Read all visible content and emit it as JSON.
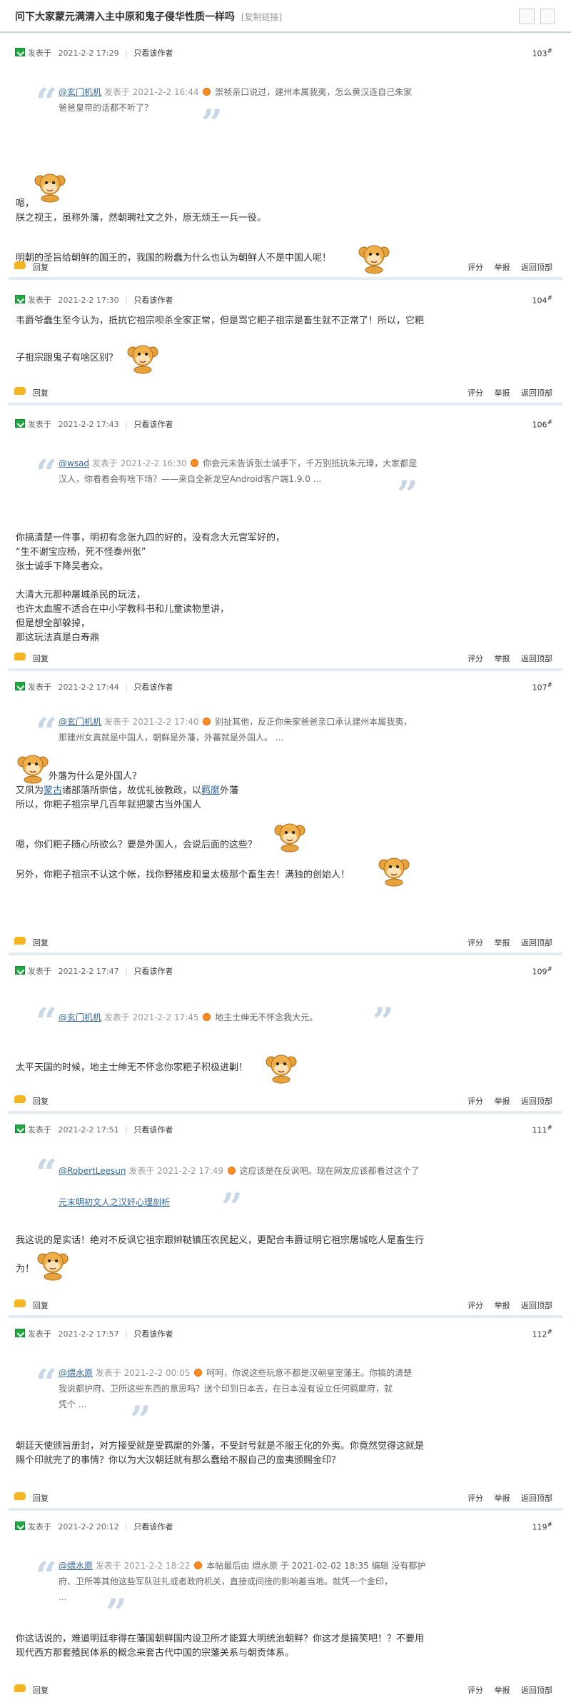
{
  "thread": {
    "title": "问下大家蒙元满清入主中原和鬼子侵华性质一样吗",
    "copy_link": "[复制链接]"
  },
  "labels": {
    "posted_at": "发表于",
    "only_author": "只看该作者",
    "reply": "回复",
    "rate": "评分",
    "report": "举报",
    "back_top": "返回顶部",
    "floor_suffix": "#"
  },
  "posts": [
    {
      "date": "2021-2-2 17:29",
      "floor": "103",
      "quote": {
        "user": "@玄门机机",
        "date": "发表于 2021-2-2 16:44",
        "text_l1": "崇祯亲口说过，建州本属我夷，怎么黄汉连自己朱家",
        "text_l2": "爸爸皇帝的话都不听了？"
      },
      "lines": [
        "嗯，",
        "朕之视王，虽称外藩，然朝聘社文之外，原无烦王一兵一役。",
        "明朝的圣旨给朝鲜的国王的，我国的粉蠢为什么也认为朝鲜人不是中国人呢！"
      ]
    },
    {
      "date": "2021-2-2 17:30",
      "floor": "104",
      "lines": [
        "韦爵爷蠢生至今认为，抵抗它祖宗呗杀全家正常，但是骂它粑子祖宗是畜生就不正常了！所以，它粑",
        "子祖宗跟鬼子有啥区别？"
      ]
    },
    {
      "date": "2021-2-2 17:43",
      "floor": "106",
      "quote": {
        "user": "@wsad",
        "date": "发表于 2021-2-2 16:30",
        "text_l1": "你会元末告诉张士诚手下，千万别抵抗朱元璋，大家都是",
        "text_l2": "汉人，你看看会有啥下场？——来自全新龙空Android客户端1.9.0 ..."
      },
      "lines": [
        "你搞清楚一件事，明初有念张九四的好的，没有念大元宫军好的，",
        "“生不谢宝应杨，死不怪泰州张”",
        "张士诚手下降吴者众。",
        "大清大元那种屠城杀民的玩法，",
        "也许太血腥不适合在中小学教科书和儿童读物里讲，",
        "但是想全部躲掉，",
        "那这玩法真是白寿鼎"
      ]
    },
    {
      "date": "2021-2-2 17:44",
      "floor": "107",
      "quote": {
        "user": "@玄门机机",
        "date": "发表于 2021-2-2 17:40",
        "text_l1": "别扯其他，反正你朱家爸爸亲口承认建州本属我夷，",
        "text_l2": "那建州女真就是中国人，朝鲜是外藩，外蕃就是外国人。 ..."
      },
      "lines": [
        "外藩为什么是外国人？",
        "又夙为",
        "诸部落所崇信，故优礼彼教政，以",
        "外藩",
        "所以，你粑子祖宗早几百年就把蒙古当外国人",
        "嗯，你们粑子随心所欲么？要是外国人，会说后面的这些？",
        "另外，你粑子祖宗不认这个帐，找你野猪皮和皇太极那个畜生去！满独的创始人！"
      ],
      "links": [
        "蒙古",
        "羁縻"
      ]
    },
    {
      "date": "2021-2-2 17:47",
      "floor": "109",
      "quote": {
        "user": "@玄门机机",
        "date": "发表于 2021-2-2 17:45",
        "text_l1": "地主士绅无不怀念我大元。",
        "text_l2": ""
      },
      "lines": [
        "太平天国的时候，地主士绅无不怀念你家粑子积极进剿！"
      ]
    },
    {
      "date": "2021-2-2 17:51",
      "floor": "111",
      "quote": {
        "user": "@RobertLeesun",
        "date": "发表于 2021-2-2 17:49",
        "text_l1": "这应该是在反讽吧。现在网友应该都看过这个了",
        "text_l2": "元末明初文人之汉奸心理剖析"
      },
      "lines": [
        "我这说的是实话！绝对不反讽它祖宗跟辫鞑镇压农民起义，更配合韦爵证明它祖宗屠城吃人是畜生行",
        "为！"
      ]
    },
    {
      "date": "2021-2-2 17:57",
      "floor": "112",
      "quote": {
        "user": "@煨水原",
        "date": "发表于 2021-2-2 00:05",
        "text_l1": "呵呵，你说这些玩意不都是汉朝皇室藩王。你搞的清楚",
        "text_l2": "我说都护府、卫所这些东西的意思吗？送个印到日本去，在日本没有设立任何羁縻府，就",
        "text_l3": "凭个 ..."
      },
      "lines": [
        "朝廷天使颁旨册封，对方接受就是受羁縻的外藩，不受封号就是不服王化的外夷。你竟然觉得这就是",
        "赐个印就完了的事情？你以为大汉朝廷就有那么蠢给不服自己的蛮夷颁赐金印？"
      ]
    },
    {
      "date": "2021-2-2 20:12",
      "floor": "119",
      "quote": {
        "user": "@煨水原",
        "date": "发表于 2021-2-2 18:22",
        "text_l1": "本帖最后由 煨水原 于 2021-02-02 18:35 编辑 没有都护",
        "text_l2": "府、卫所等其他这些军队驻扎或者政府机关，直接或间接的影响着当地。就凭一个金印，",
        "text_l3": "..."
      },
      "lines": [
        "你这话说的，难道明廷非得在藩国朝鲜国内设卫所才能算大明统治朝鲜？你这才是搞笑吧！？不要用",
        "现代西方那套殖民体系的概念来套古代中国的宗藩关系与朝贡体系。"
      ]
    }
  ],
  "icons": {
    "post": "post-check-icon",
    "reply": "reply-icon",
    "quote_open": "quote-open-icon",
    "quote_close": "quote-close-icon",
    "emoji": "monkey-emoji-icon",
    "quote_jump": "quote-jump-icon"
  },
  "colors": {
    "link": "#336699",
    "divider": "#e2ebf2",
    "quote_mark": "#c8d7e6",
    "post_icon": "#22a745",
    "reply_icon": "#f4b523"
  }
}
